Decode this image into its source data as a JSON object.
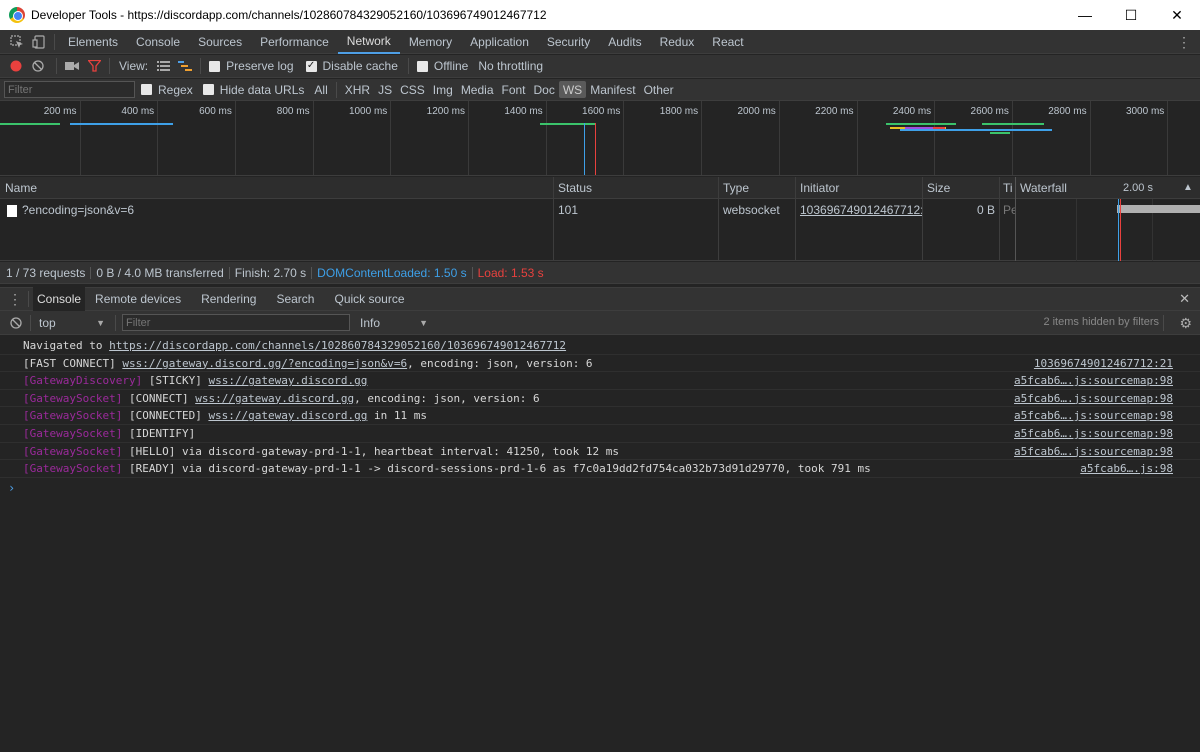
{
  "window": {
    "title": "Developer Tools - https://discordapp.com/channels/102860784329052160/103696749012467712",
    "minimize": "—",
    "maximize": "☐",
    "close": "✕"
  },
  "tabs": [
    "Elements",
    "Console",
    "Sources",
    "Performance",
    "Network",
    "Memory",
    "Application",
    "Security",
    "Audits",
    "Redux",
    "React"
  ],
  "selected_tab": "Network",
  "network_toolbar": {
    "view_label": "View:",
    "preserve_log": "Preserve log",
    "disable_cache": "Disable cache",
    "offline": "Offline",
    "throttling": "No throttling"
  },
  "filter_bar": {
    "placeholder": "Filter",
    "regex": "Regex",
    "hide_data_urls": "Hide data URLs",
    "types": [
      "All",
      "XHR",
      "JS",
      "CSS",
      "Img",
      "Media",
      "Font",
      "Doc",
      "WS",
      "Manifest",
      "Other"
    ],
    "selected_type": "WS"
  },
  "overview": {
    "ticks": [
      "200 ms",
      "400 ms",
      "600 ms",
      "800 ms",
      "1000 ms",
      "1200 ms",
      "1400 ms",
      "1600 ms",
      "1800 ms",
      "2000 ms",
      "2200 ms",
      "2400 ms",
      "2600 ms",
      "2800 ms",
      "3000 ms"
    ]
  },
  "table": {
    "headers": {
      "name": "Name",
      "status": "Status",
      "type": "Type",
      "initiator": "Initiator",
      "size": "Size",
      "time": "Ti",
      "waterfall": "Waterfall",
      "waterfall_tick": "2.00 s"
    },
    "rows": [
      {
        "name": "?encoding=json&v=6",
        "status": "101",
        "type": "websocket",
        "initiator": "103696749012467712:...",
        "size": "0 B",
        "time": "Pe"
      }
    ]
  },
  "summary": {
    "requests": "1 / 73 requests",
    "transferred": "0 B / 4.0 MB transferred",
    "finish": "Finish: 2.70 s",
    "dcl": "DOMContentLoaded: 1.50 s",
    "load": "Load: 1.53 s",
    "dcl_color": "#3ea0e8",
    "load_color": "#e8413e"
  },
  "drawer": {
    "tabs": [
      "Console",
      "Remote devices",
      "Rendering",
      "Search",
      "Quick source"
    ],
    "selected": "Console"
  },
  "console_toolbar": {
    "context": "top",
    "filter_placeholder": "Filter",
    "level": "Info",
    "hidden": "2 items hidden by filters"
  },
  "console": {
    "messages": [
      {
        "tag": "",
        "pre": "Navigated to ",
        "link": "https://discordapp.com/channels/102860784329052160/103696749012467712",
        "post": "",
        "source": ""
      },
      {
        "tag": "",
        "pre": "[FAST CONNECT] ",
        "link": "wss://gateway.discord.gg/?encoding=json&v=6",
        "post": ", encoding: json, version: 6",
        "source": "103696749012467712:21"
      },
      {
        "tag": "[GatewayDiscovery]",
        "pre": " [STICKY] ",
        "link": "wss://gateway.discord.gg",
        "post": "",
        "source": "a5fcab6….js:sourcemap:98"
      },
      {
        "tag": "[GatewaySocket]",
        "pre": " [CONNECT] ",
        "link": "wss://gateway.discord.gg",
        "post": ", encoding: json, version: 6",
        "source": "a5fcab6….js:sourcemap:98"
      },
      {
        "tag": "[GatewaySocket]",
        "pre": " [CONNECTED] ",
        "link": "wss://gateway.discord.gg",
        "post": " in 11 ms",
        "source": "a5fcab6….js:sourcemap:98"
      },
      {
        "tag": "[GatewaySocket]",
        "pre": " [IDENTIFY]",
        "link": "",
        "post": "",
        "source": "a5fcab6….js:sourcemap:98"
      },
      {
        "tag": "[GatewaySocket]",
        "pre": " [HELLO] via discord-gateway-prd-1-1, heartbeat interval: 41250, took 12 ms",
        "link": "",
        "post": "",
        "source": "a5fcab6….js:sourcemap:98"
      },
      {
        "tag": "[GatewaySocket]",
        "pre": " [READY] via discord-gateway-prd-1-1 -> discord-sessions-prd-1-6 as f7c0a19dd2fd754ca032b73d91d29770, took 791 ms",
        "link": "",
        "post": "",
        "source": "a5fcab6….js:98"
      }
    ],
    "prompt": "›"
  }
}
